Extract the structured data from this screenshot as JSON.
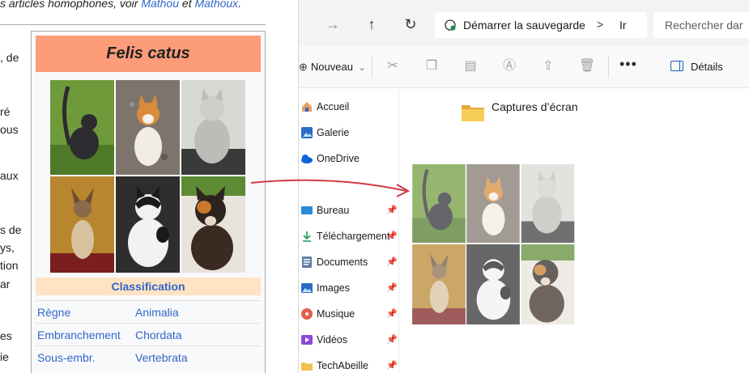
{
  "wiki": {
    "top_text_prefix": "s articles homophones, voir ",
    "link_1": "Mathou",
    "conjunction": " et ",
    "link_2": "Mathoux",
    "end_period": ".",
    "fragments": [
      ", de",
      "ré",
      "ous",
      "aux",
      "s de",
      "ys,",
      "tion",
      "ar",
      "es",
      "ie"
    ],
    "infobox": {
      "title": "Felis catus",
      "classification_header": "Classification",
      "rows": [
        {
          "key": "Règne",
          "value": "Animalia"
        },
        {
          "key": "Embranchement",
          "value": "Chordata"
        },
        {
          "key": "Sous-embr.",
          "value": "Vertebrata"
        }
      ],
      "title_color": "#fc9c78",
      "classification_color": "#ffe3c4"
    }
  },
  "explorer": {
    "address": {
      "label": "Démarrer la sauvegarde",
      "chevron": ">",
      "next": "Ir"
    },
    "search_placeholder": "Rechercher dar",
    "toolbar": {
      "new_label": "Nouveau",
      "new_caret": "⌄",
      "more": "•••",
      "details_label": "Détails"
    },
    "sidebar": [
      {
        "label": "Accueil",
        "icon": "home-icon",
        "pinned": false
      },
      {
        "label": "Galerie",
        "icon": "gallery-icon",
        "pinned": false
      },
      {
        "label": "OneDrive",
        "icon": "onedrive-icon",
        "pinned": false
      },
      {
        "label": "Bureau",
        "icon": "desktop-icon",
        "pinned": true
      },
      {
        "label": "Téléchargement",
        "icon": "download-icon",
        "pinned": true
      },
      {
        "label": "Documents",
        "icon": "documents-icon",
        "pinned": true
      },
      {
        "label": "Images",
        "icon": "images-icon",
        "pinned": true
      },
      {
        "label": "Musique",
        "icon": "music-icon",
        "pinned": true
      },
      {
        "label": "Vidéos",
        "icon": "videos-icon",
        "pinned": true
      },
      {
        "label": "TechAbeille",
        "icon": "folder-icon",
        "pinned": true
      }
    ],
    "content": {
      "folder_label": "Captures d’écran"
    }
  }
}
